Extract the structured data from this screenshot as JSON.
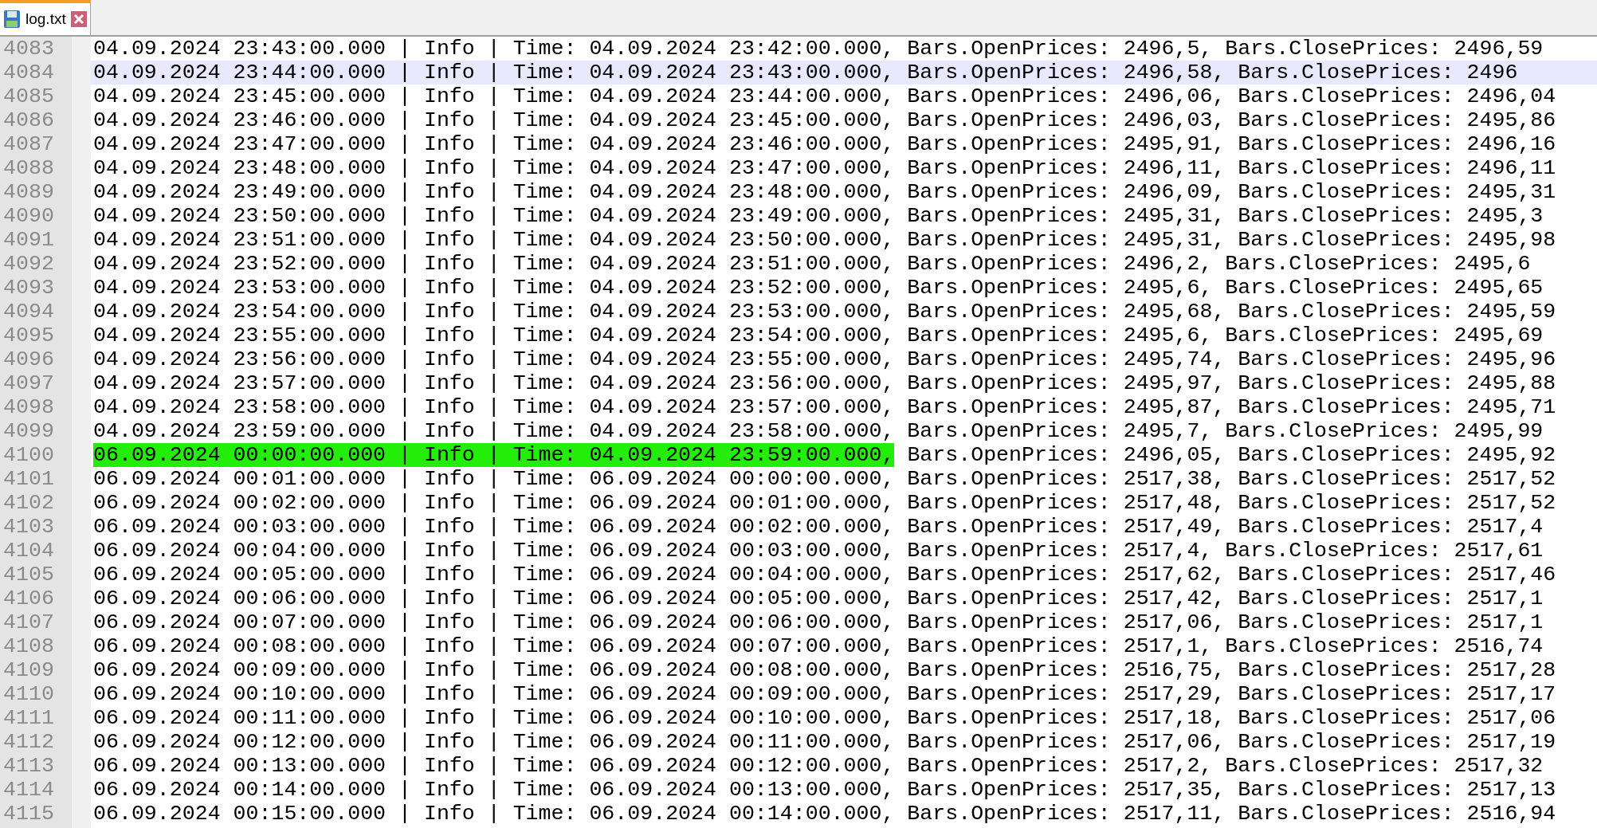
{
  "tabs": [
    {
      "label": "log.txt",
      "selected": true,
      "modified": false
    }
  ],
  "lines": [
    {
      "number": "4083",
      "text": "04.09.2024 23:43:00.000 | Info | Time: 04.09.2024 23:42:00.000, Bars.OpenPrices: 2496,5, Bars.ClosePrices: 2496,59",
      "current": false
    },
    {
      "number": "4084",
      "text": "04.09.2024 23:44:00.000 | Info | Time: 04.09.2024 23:43:00.000, Bars.OpenPrices: 2496,58, Bars.ClosePrices: 2496",
      "current": true
    },
    {
      "number": "4085",
      "text": "04.09.2024 23:45:00.000 | Info | Time: 04.09.2024 23:44:00.000, Bars.OpenPrices: 2496,06, Bars.ClosePrices: 2496,04",
      "current": false
    },
    {
      "number": "4086",
      "text": "04.09.2024 23:46:00.000 | Info | Time: 04.09.2024 23:45:00.000, Bars.OpenPrices: 2496,03, Bars.ClosePrices: 2495,86",
      "current": false
    },
    {
      "number": "4087",
      "text": "04.09.2024 23:47:00.000 | Info | Time: 04.09.2024 23:46:00.000, Bars.OpenPrices: 2495,91, Bars.ClosePrices: 2496,16",
      "current": false
    },
    {
      "number": "4088",
      "text": "04.09.2024 23:48:00.000 | Info | Time: 04.09.2024 23:47:00.000, Bars.OpenPrices: 2496,11, Bars.ClosePrices: 2496,11",
      "current": false
    },
    {
      "number": "4089",
      "text": "04.09.2024 23:49:00.000 | Info | Time: 04.09.2024 23:48:00.000, Bars.OpenPrices: 2496,09, Bars.ClosePrices: 2495,31",
      "current": false
    },
    {
      "number": "4090",
      "text": "04.09.2024 23:50:00.000 | Info | Time: 04.09.2024 23:49:00.000, Bars.OpenPrices: 2495,31, Bars.ClosePrices: 2495,3",
      "current": false
    },
    {
      "number": "4091",
      "text": "04.09.2024 23:51:00.000 | Info | Time: 04.09.2024 23:50:00.000, Bars.OpenPrices: 2495,31, Bars.ClosePrices: 2495,98",
      "current": false
    },
    {
      "number": "4092",
      "text": "04.09.2024 23:52:00.000 | Info | Time: 04.09.2024 23:51:00.000, Bars.OpenPrices: 2496,2, Bars.ClosePrices: 2495,6",
      "current": false
    },
    {
      "number": "4093",
      "text": "04.09.2024 23:53:00.000 | Info | Time: 04.09.2024 23:52:00.000, Bars.OpenPrices: 2495,6, Bars.ClosePrices: 2495,65",
      "current": false
    },
    {
      "number": "4094",
      "text": "04.09.2024 23:54:00.000 | Info | Time: 04.09.2024 23:53:00.000, Bars.OpenPrices: 2495,68, Bars.ClosePrices: 2495,59",
      "current": false
    },
    {
      "number": "4095",
      "text": "04.09.2024 23:55:00.000 | Info | Time: 04.09.2024 23:54:00.000, Bars.OpenPrices: 2495,6, Bars.ClosePrices: 2495,69",
      "current": false
    },
    {
      "number": "4096",
      "text": "04.09.2024 23:56:00.000 | Info | Time: 04.09.2024 23:55:00.000, Bars.OpenPrices: 2495,74, Bars.ClosePrices: 2495,96",
      "current": false
    },
    {
      "number": "4097",
      "text": "04.09.2024 23:57:00.000 | Info | Time: 04.09.2024 23:56:00.000, Bars.OpenPrices: 2495,97, Bars.ClosePrices: 2495,88",
      "current": false
    },
    {
      "number": "4098",
      "text": "04.09.2024 23:58:00.000 | Info | Time: 04.09.2024 23:57:00.000, Bars.OpenPrices: 2495,87, Bars.ClosePrices: 2495,71",
      "current": false
    },
    {
      "number": "4099",
      "text": "04.09.2024 23:59:00.000 | Info | Time: 04.09.2024 23:58:00.000, Bars.OpenPrices: 2495,7, Bars.ClosePrices: 2495,99",
      "current": false
    },
    {
      "number": "4100",
      "highlight": "06.09.2024 00:00:00.000 | Info | Time: 04.09.2024 23:59:00.000,",
      "text": " Bars.OpenPrices: 2496,05, Bars.ClosePrices: 2495,92",
      "current": false
    },
    {
      "number": "4101",
      "text": "06.09.2024 00:01:00.000 | Info | Time: 06.09.2024 00:00:00.000, Bars.OpenPrices: 2517,38, Bars.ClosePrices: 2517,52",
      "current": false
    },
    {
      "number": "4102",
      "text": "06.09.2024 00:02:00.000 | Info | Time: 06.09.2024 00:01:00.000, Bars.OpenPrices: 2517,48, Bars.ClosePrices: 2517,52",
      "current": false
    },
    {
      "number": "4103",
      "text": "06.09.2024 00:03:00.000 | Info | Time: 06.09.2024 00:02:00.000, Bars.OpenPrices: 2517,49, Bars.ClosePrices: 2517,4",
      "current": false
    },
    {
      "number": "4104",
      "text": "06.09.2024 00:04:00.000 | Info | Time: 06.09.2024 00:03:00.000, Bars.OpenPrices: 2517,4, Bars.ClosePrices: 2517,61",
      "current": false
    },
    {
      "number": "4105",
      "text": "06.09.2024 00:05:00.000 | Info | Time: 06.09.2024 00:04:00.000, Bars.OpenPrices: 2517,62, Bars.ClosePrices: 2517,46",
      "current": false
    },
    {
      "number": "4106",
      "text": "06.09.2024 00:06:00.000 | Info | Time: 06.09.2024 00:05:00.000, Bars.OpenPrices: 2517,42, Bars.ClosePrices: 2517,1",
      "current": false
    },
    {
      "number": "4107",
      "text": "06.09.2024 00:07:00.000 | Info | Time: 06.09.2024 00:06:00.000, Bars.OpenPrices: 2517,06, Bars.ClosePrices: 2517,1",
      "current": false
    },
    {
      "number": "4108",
      "text": "06.09.2024 00:08:00.000 | Info | Time: 06.09.2024 00:07:00.000, Bars.OpenPrices: 2517,1, Bars.ClosePrices: 2516,74",
      "current": false
    },
    {
      "number": "4109",
      "text": "06.09.2024 00:09:00.000 | Info | Time: 06.09.2024 00:08:00.000, Bars.OpenPrices: 2516,75, Bars.ClosePrices: 2517,28",
      "current": false
    },
    {
      "number": "4110",
      "text": "06.09.2024 00:10:00.000 | Info | Time: 06.09.2024 00:09:00.000, Bars.OpenPrices: 2517,29, Bars.ClosePrices: 2517,17",
      "current": false
    },
    {
      "number": "4111",
      "text": "06.09.2024 00:11:00.000 | Info | Time: 06.09.2024 00:10:00.000, Bars.OpenPrices: 2517,18, Bars.ClosePrices: 2517,06",
      "current": false
    },
    {
      "number": "4112",
      "text": "06.09.2024 00:12:00.000 | Info | Time: 06.09.2024 00:11:00.000, Bars.OpenPrices: 2517,06, Bars.ClosePrices: 2517,19",
      "current": false
    },
    {
      "number": "4113",
      "text": "06.09.2024 00:13:00.000 | Info | Time: 06.09.2024 00:12:00.000, Bars.OpenPrices: 2517,2, Bars.ClosePrices: 2517,32",
      "current": false
    },
    {
      "number": "4114",
      "text": "06.09.2024 00:14:00.000 | Info | Time: 06.09.2024 00:13:00.000, Bars.OpenPrices: 2517,35, Bars.ClosePrices: 2517,13",
      "current": false
    },
    {
      "number": "4115",
      "text": "06.09.2024 00:15:00.000 | Info | Time: 06.09.2024 00:14:00.000, Bars.OpenPrices: 2517,11, Bars.ClosePrices: 2516,94",
      "current": false
    }
  ]
}
